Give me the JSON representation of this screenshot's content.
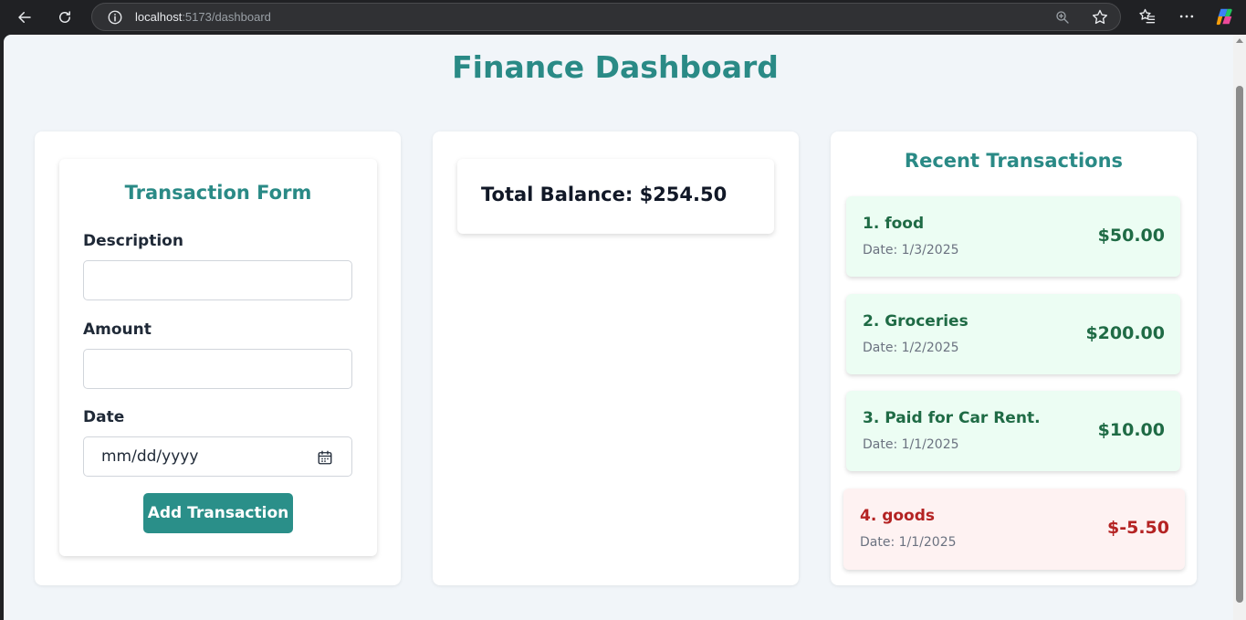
{
  "browser": {
    "url_host": "localhost",
    "url_path": ":5173/dashboard"
  },
  "page": {
    "title": "Finance Dashboard"
  },
  "form": {
    "title": "Transaction Form",
    "description_label": "Description",
    "description_value": "",
    "amount_label": "Amount",
    "amount_value": "",
    "date_label": "Date",
    "date_placeholder": "mm/dd/yyyy",
    "submit_label": "Add Transaction"
  },
  "balance": {
    "text": "Total Balance: $254.50"
  },
  "recent": {
    "title": "Recent Transactions",
    "items": [
      {
        "name": "1. food",
        "date": "Date: 1/3/2025",
        "amount": "$50.00",
        "type": "income"
      },
      {
        "name": "2. Groceries",
        "date": "Date: 1/2/2025",
        "amount": "$200.00",
        "type": "income"
      },
      {
        "name": "3. Paid for Car Rent.",
        "date": "Date: 1/1/2025",
        "amount": "$10.00",
        "type": "income"
      },
      {
        "name": "4. goods",
        "date": "Date: 1/1/2025",
        "amount": "$-5.50",
        "type": "expense"
      }
    ]
  },
  "colors": {
    "accent": "#2a8a86",
    "button": "#2a8f89",
    "income_bg": "#ecfdf3",
    "income_text": "#1f6b45",
    "expense_bg": "#fef2f2",
    "expense_text": "#b42323"
  },
  "icons": {
    "back": "back-arrow-icon",
    "reload": "reload-icon",
    "info": "info-icon",
    "zoom": "zoom-icon",
    "favorite": "star-icon",
    "favorites_bar": "favorites-icon",
    "menu": "more-icon",
    "copilot": "copilot-icon",
    "calendar": "calendar-icon"
  }
}
